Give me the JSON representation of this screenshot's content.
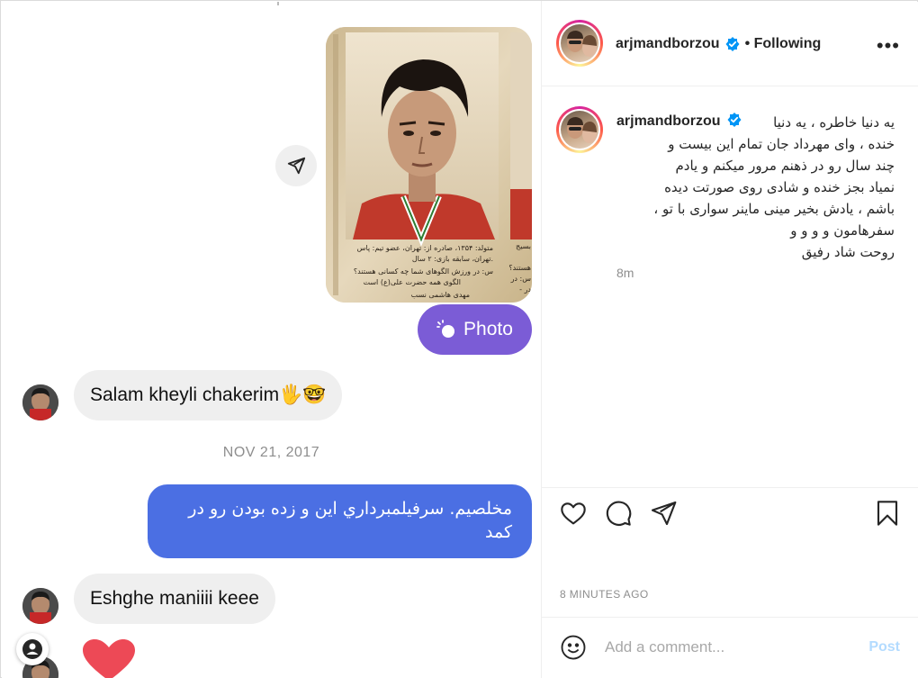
{
  "chat": {
    "photo_label": "Photo",
    "msg1": "Salam kheyli chakerim🖐️🤓",
    "date_separator": "NOV 21, 2017",
    "msg2": "مخلصیم. سرفیلمبرداري این و زده بودن رو در کمد",
    "msg3": "Eshghe maniiii keee",
    "clipping_lines": [
      "متولد: ۱۳۵۴، صادره از: تهران، عضو تیم: پاس",
      "تهران، سابقه بازی: ۲ سال.",
      "س: در ورزش الگوهای شما چه کسانی هستند؟",
      "الگوی همه حضرت علی(ع) است",
      "مهدی هاشمی نسب"
    ],
    "clipping_side_lines": [
      "بسیج",
      "هستند؟",
      "س: در",
      "- در"
    ]
  },
  "post": {
    "username": "arjmandborzou",
    "following_label": "• Following",
    "caption": "یه دنیا خاطره ، یه دنیا\nخنده ، وای مهرداد جان تمام این بیست و\nچند سال رو در ذهنم مرور میکنم و یادم\nنمیاد بجز خنده و شادی روی صورتت دیده\nباشم ، یادش بخیر مینی ماینر سواری با تو ،\nسفرهامون و و و و\nروحت شاد رفیق",
    "time_ago": "8m",
    "posted_time": "8 MINUTES AGO",
    "comment_placeholder": "Add a comment...",
    "post_label": "Post"
  },
  "colors": {
    "accent_blue": "#0095f6",
    "outgoing_bubble": "#4b6fe3",
    "photo_pill": "#7b5cd6",
    "heart": "#ed4956"
  }
}
